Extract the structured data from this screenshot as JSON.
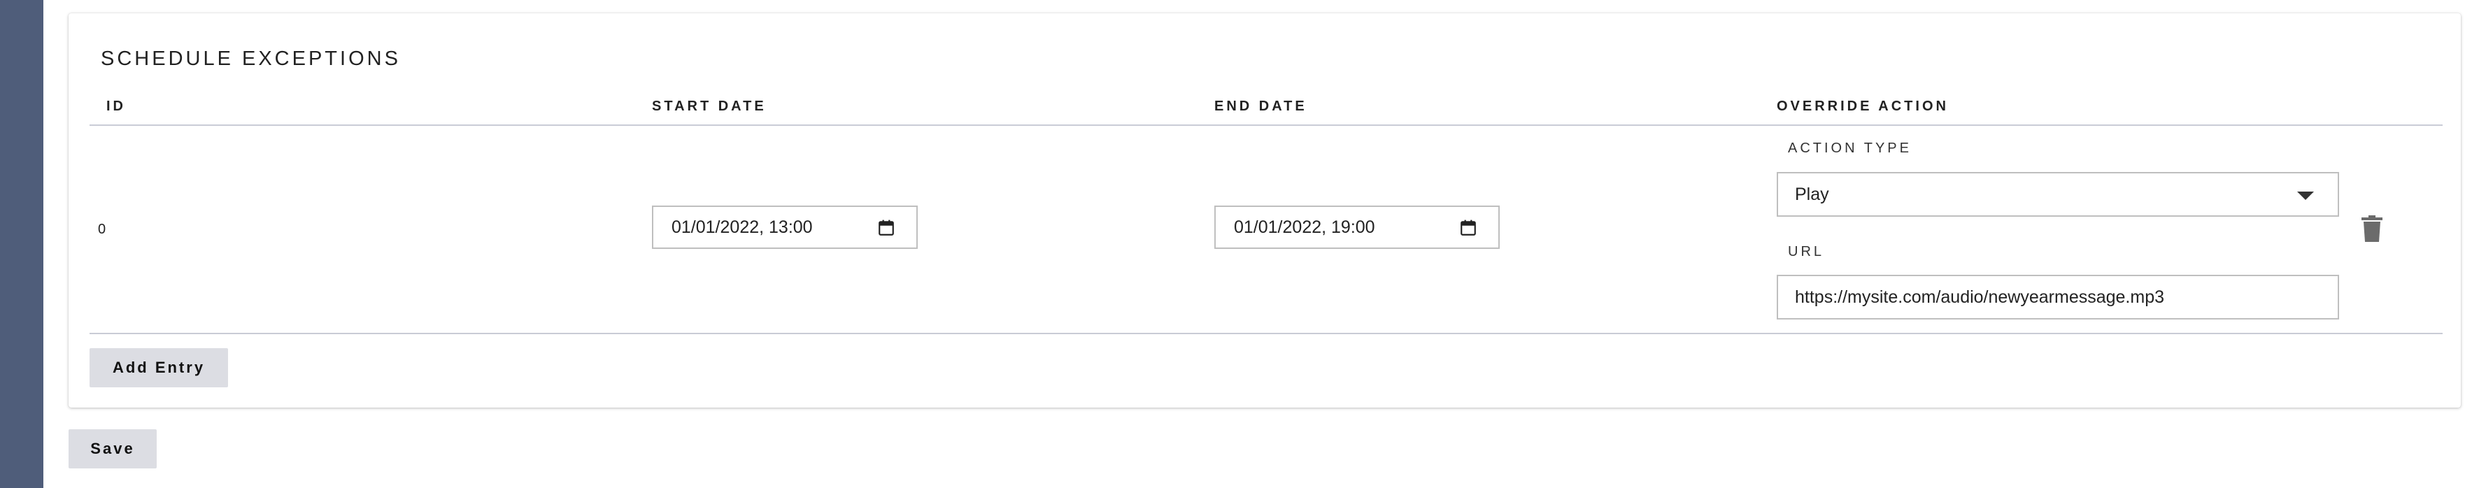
{
  "section": {
    "title": "SCHEDULE EXCEPTIONS"
  },
  "table": {
    "columns": [
      "ID",
      "START DATE",
      "END DATE",
      "OVERRIDE ACTION"
    ],
    "rows": [
      {
        "id": "0",
        "start_date": "01/01/2022, 13:00",
        "end_date": "01/01/2022, 19:00",
        "action_type_label": "ACTION TYPE",
        "action_type_value": "Play",
        "url_label": "URL",
        "url_value": "https://mysite.com/audio/newyearmessage.mp3"
      }
    ]
  },
  "buttons": {
    "add_entry": "Add Entry",
    "save": "Save"
  },
  "colors": {
    "sidebar": "#4f5d7a",
    "button_bg": "#dcdde3",
    "divider": "#c9ccd6"
  },
  "icons": {
    "calendar": "calendar-icon",
    "dropdown": "chevron-down-icon",
    "delete": "trash-icon"
  }
}
